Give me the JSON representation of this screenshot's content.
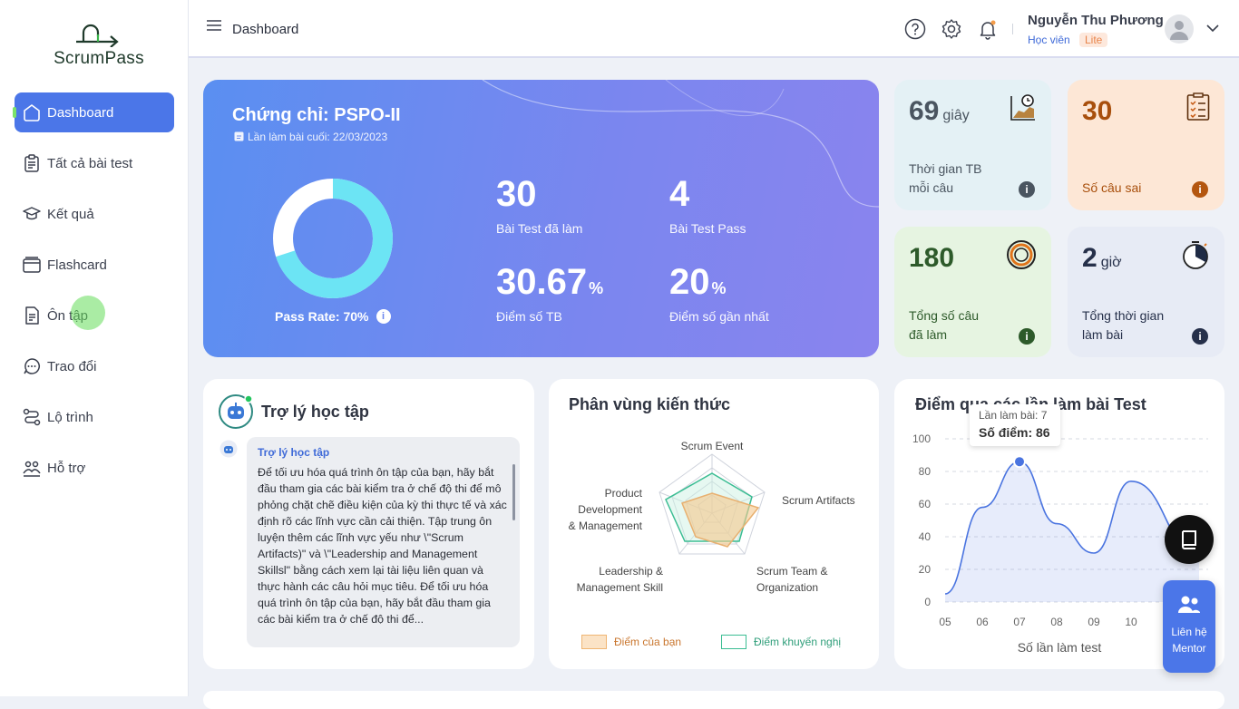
{
  "brand": {
    "name": "ScrumPass"
  },
  "sidebar": {
    "items": [
      {
        "label": "Dashboard",
        "icon": "home-icon"
      },
      {
        "label": "Tất cả bài test",
        "icon": "clipboard-icon"
      },
      {
        "label": "Kết quả",
        "icon": "graduation-cap-icon"
      },
      {
        "label": "Flashcard",
        "icon": "cards-icon"
      },
      {
        "label": "Ôn tập",
        "icon": "notes-icon"
      },
      {
        "label": "Trao đổi",
        "icon": "chat-icon"
      },
      {
        "label": "Lộ trình",
        "icon": "route-icon"
      },
      {
        "label": "Hỗ trợ",
        "icon": "support-icon"
      }
    ]
  },
  "topbar": {
    "title": "Dashboard",
    "user_name": "Nguyễn Thu Phương",
    "user_role": "Học viên",
    "user_plan": "Lite"
  },
  "hero": {
    "title": "Chứng chỉ: PSPO-II",
    "last_attempt": "Lần làm bài cuối: 22/03/2023",
    "pass_rate_label": "Pass Rate: 70%",
    "pass_rate": 0.7,
    "stats": [
      {
        "value": "30",
        "unit": "",
        "label": "Bài Test đã làm"
      },
      {
        "value": "4",
        "unit": "",
        "label": "Bài Test Pass"
      },
      {
        "value": "30.67",
        "unit": "%",
        "label": "Điểm số TB"
      },
      {
        "value": "20",
        "unit": "%",
        "label": "Điểm số gần nhất"
      }
    ]
  },
  "cards": [
    {
      "value": "69",
      "unit": "giây",
      "label1": "Thời gian TB",
      "label2": "mỗi câu",
      "color": "#4a5560"
    },
    {
      "value": "30",
      "unit": "",
      "label1": "",
      "label2": "Số câu sai",
      "color": "#a84f0c"
    },
    {
      "value": "180",
      "unit": "",
      "label1": "Tổng số câu",
      "label2": "đã làm",
      "color": "#2d5a2a"
    },
    {
      "value": "2",
      "unit": "giờ",
      "label1": "Tổng thời gian",
      "label2": "làm bài",
      "color": "#26304a"
    }
  ],
  "assistant": {
    "title": "Trợ lý học tập",
    "sender": "Trợ lý học tập",
    "message": "Để tối ưu hóa quá trình ôn tập của bạn, hãy bắt đầu tham gia các bài kiểm tra ở chế độ thi để mô phỏng chặt chẽ điều kiện của kỳ thi thực tế và xác định rõ các lĩnh vực cần cải thiện. Tập trung ôn luyện thêm các lĩnh vực yếu như \\\"Scrum Artifacts)\" và \\\"Leadership and Management Skillsl\" bằng cách xem lại tài liệu liên quan và thực hành các câu hỏi mục tiêu. Để tối ưu hóa quá trình ôn tập của bạn, hãy bắt đầu tham gia các bài kiểm tra ở chế độ thi để..."
  },
  "radar": {
    "title": "Phân vùng kiến thức",
    "axes": [
      "Scrum Event",
      "Scrum Artifacts",
      "Scrum Team &",
      "Organization",
      "Leadership &",
      "Management Skill",
      "Product",
      "Development",
      "& Management"
    ],
    "legend_yours": "Điểm của bạn",
    "legend_recommended": "Điểm khuyến nghị"
  },
  "chart_data": {
    "type": "area",
    "title": "Điểm qua các lần làm bài Test",
    "xlabel": "Số lần làm test",
    "x": [
      "05",
      "06",
      "07",
      "08",
      "09",
      "10"
    ],
    "y": [
      5,
      58,
      86,
      48,
      30,
      74
    ],
    "ylim": [
      0,
      100
    ],
    "yticks": [
      "100",
      "80",
      "60",
      "40",
      "20",
      "0"
    ],
    "tooltip_attempt": "Lần làm bài: 7",
    "tooltip_score": "Số điểm: 86"
  },
  "fab": {
    "mentor_line1": "Liên hệ",
    "mentor_line2": "Mentor"
  }
}
